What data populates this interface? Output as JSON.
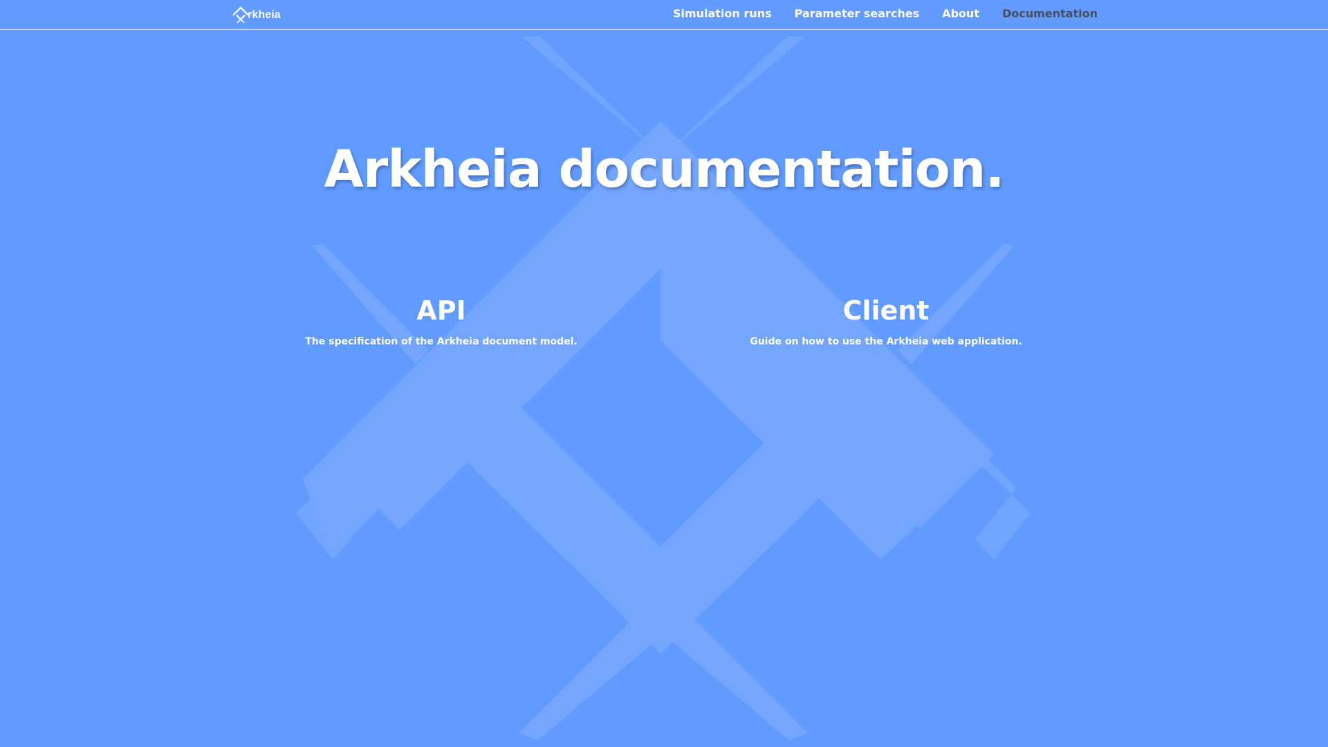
{
  "header": {
    "brand_text": "rkheia",
    "brand_logo": "arkheia-logo",
    "nav": [
      {
        "label": "Simulation runs",
        "active": false
      },
      {
        "label": "Parameter searches",
        "active": false
      },
      {
        "label": "About",
        "active": false
      },
      {
        "label": "Documentation",
        "active": true
      }
    ]
  },
  "hero": {
    "title": "Arkheia documentation."
  },
  "cards": [
    {
      "title": "API",
      "description": "The specification of the Arkheia document model."
    },
    {
      "title": "Client",
      "description": "Guide on how to use the Arkheia web application."
    }
  ],
  "colors": {
    "background": "#619bff",
    "watermark": "#75a7ff",
    "text": "#ffffff",
    "active_nav": "#4a4f5c"
  }
}
